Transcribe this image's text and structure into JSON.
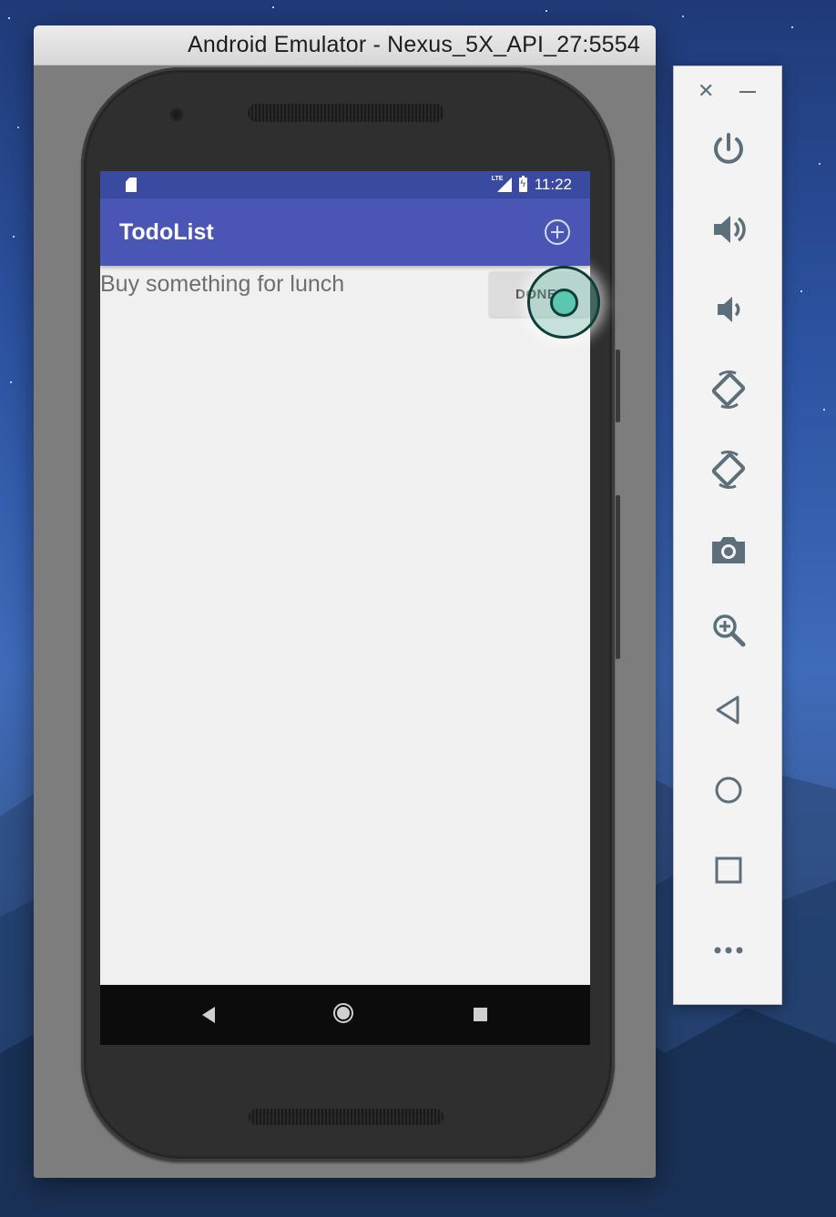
{
  "window": {
    "title": "Android Emulator - Nexus_5X_API_27:5554"
  },
  "statusbar": {
    "lte": "LTE",
    "time": "11:22"
  },
  "app": {
    "title": "TodoList",
    "add_icon": "add-circle-icon",
    "tasks": [
      {
        "label": "Buy something for lunch",
        "button": "DONE"
      }
    ]
  },
  "navbar": {
    "back_icon": "back-icon",
    "home_icon": "home-icon",
    "recents_icon": "recents-icon"
  },
  "toolbar": {
    "close": "✕",
    "items": [
      "power-icon",
      "volume-up-icon",
      "volume-down-icon",
      "rotate-left-icon",
      "rotate-right-icon",
      "camera-icon",
      "zoom-icon",
      "back-icon",
      "home-icon",
      "overview-icon",
      "more-icon"
    ]
  },
  "colors": {
    "statusbar": "#3a4aa0",
    "appbar": "#4a56b3",
    "screen_bg": "#f0f0f0",
    "toolbar_icon": "#5c6f7a",
    "touch_indicator": "#5bc7ae"
  }
}
